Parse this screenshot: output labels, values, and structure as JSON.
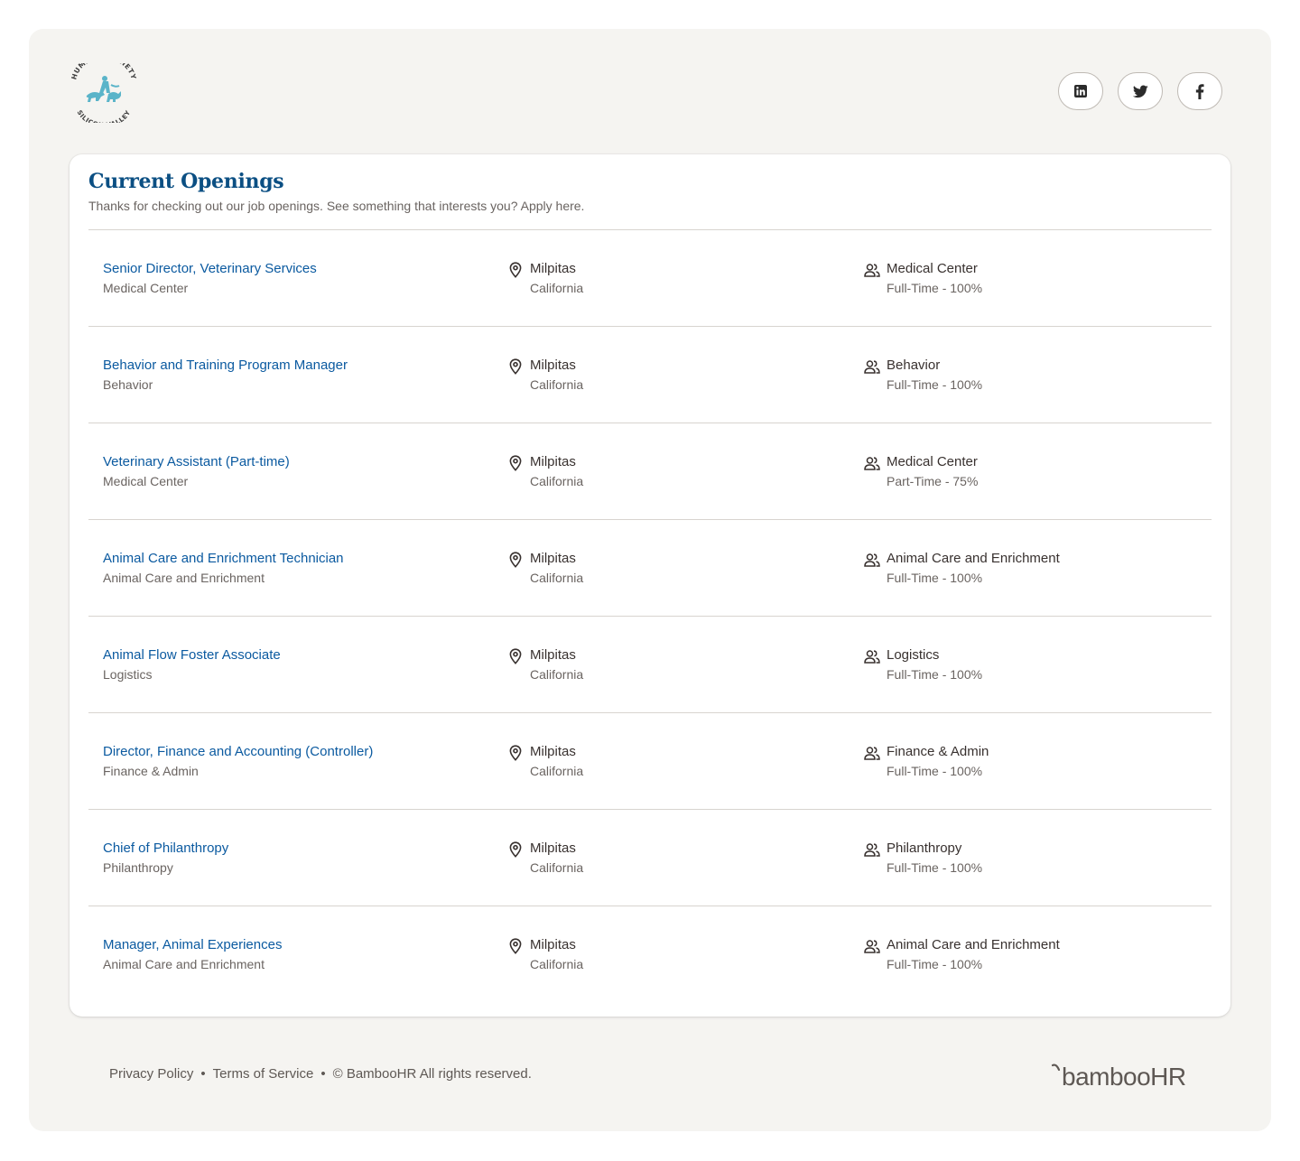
{
  "org": {
    "logo_top_text": "HUMANE SOCIETY",
    "logo_bottom_text": "SILICON VALLEY"
  },
  "social": [
    {
      "name": "linkedin",
      "icon": "linkedin-icon"
    },
    {
      "name": "twitter",
      "icon": "twitter-icon"
    },
    {
      "name": "facebook",
      "icon": "facebook-icon"
    }
  ],
  "openings": {
    "title": "Current Openings",
    "subtitle": "Thanks for checking out our job openings. See something that interests you? Apply here.",
    "jobs": [
      {
        "title": "Senior Director, Veterinary Services",
        "department": "Medical Center",
        "city": "Milpitas",
        "state": "California",
        "team": "Medical Center",
        "type": "Full-Time - 100%"
      },
      {
        "title": "Behavior and Training Program Manager",
        "department": "Behavior",
        "city": "Milpitas",
        "state": "California",
        "team": "Behavior",
        "type": "Full-Time - 100%"
      },
      {
        "title": "Veterinary Assistant (Part-time)",
        "department": "Medical Center",
        "city": "Milpitas",
        "state": "California",
        "team": "Medical Center",
        "type": "Part-Time - 75%"
      },
      {
        "title": "Animal Care and Enrichment Technician",
        "department": "Animal Care and Enrichment",
        "city": "Milpitas",
        "state": "California",
        "team": "Animal Care and Enrichment",
        "type": "Full-Time - 100%"
      },
      {
        "title": "Animal Flow Foster Associate",
        "department": "Logistics",
        "city": "Milpitas",
        "state": "California",
        "team": "Logistics",
        "type": "Full-Time - 100%"
      },
      {
        "title": "Director, Finance and Accounting (Controller)",
        "department": "Finance & Admin",
        "city": "Milpitas",
        "state": "California",
        "team": "Finance & Admin",
        "type": "Full-Time - 100%"
      },
      {
        "title": "Chief of Philanthropy",
        "department": "Philanthropy",
        "city": "Milpitas",
        "state": "California",
        "team": "Philanthropy",
        "type": "Full-Time - 100%"
      },
      {
        "title": "Manager, Animal Experiences",
        "department": "Animal Care and Enrichment",
        "city": "Milpitas",
        "state": "California",
        "team": "Animal Care and Enrichment",
        "type": "Full-Time - 100%"
      }
    ]
  },
  "footer": {
    "privacy": "Privacy Policy",
    "terms": "Terms of Service",
    "separator": "•",
    "copyright": "© BambooHR All rights reserved.",
    "brand": "bambooHR"
  },
  "colors": {
    "frame_bg": "#f5f4f1",
    "title_blue": "#0b4f83",
    "link_blue": "#0b5aa0",
    "logo_teal": "#5ab4c9"
  }
}
